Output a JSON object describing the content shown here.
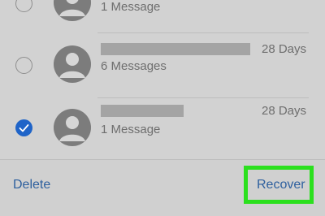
{
  "messages": [
    {
      "count_label": "1 Message",
      "age_label": "",
      "selected": false
    },
    {
      "count_label": "6 Messages",
      "age_label": "28 Days",
      "selected": false
    },
    {
      "count_label": "1 Message",
      "age_label": "28 Days",
      "selected": true
    }
  ],
  "toolbar": {
    "delete_label": "Delete",
    "recover_label": "Recover"
  },
  "colors": {
    "accent": "#2d5f9e",
    "checkbox": "#1f64c8",
    "highlight": "#2be01e"
  }
}
